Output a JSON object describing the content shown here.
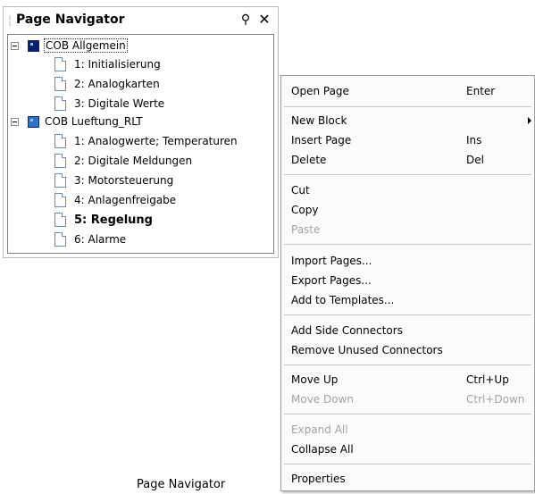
{
  "navigator": {
    "title": "Page Navigator",
    "pin_glyph": "⚲",
    "close_glyph": "✕",
    "tree": [
      {
        "label": "COB Allgemein",
        "type": "block",
        "expanded": true,
        "focused": true
      },
      {
        "label": "1: Initialisierung",
        "type": "page"
      },
      {
        "label": "2: Analogkarten",
        "type": "page"
      },
      {
        "label": "3: Digitale Werte",
        "type": "page"
      },
      {
        "label": "COB Lueftung_RLT",
        "type": "block",
        "expanded": true
      },
      {
        "label": "1: Analogwerte; Temperaturen",
        "type": "page"
      },
      {
        "label": "2: Digitale Meldungen",
        "type": "page"
      },
      {
        "label": "3: Motorsteuerung",
        "type": "page"
      },
      {
        "label": "4: Anlagenfreigabe",
        "type": "page"
      },
      {
        "label": "5: Regelung",
        "type": "page",
        "bold": true
      },
      {
        "label": "6: Alarme",
        "type": "page"
      }
    ]
  },
  "caption": "Page Navigator",
  "menu": {
    "open_page": {
      "label": "Open Page",
      "shortcut": "Enter"
    },
    "new_block": {
      "label": "New Block"
    },
    "insert_page": {
      "label": "Insert Page",
      "shortcut": "Ins"
    },
    "delete": {
      "label": "Delete",
      "shortcut": "Del"
    },
    "cut": {
      "label": "Cut"
    },
    "copy": {
      "label": "Copy"
    },
    "paste": {
      "label": "Paste",
      "disabled": true
    },
    "import_pages": {
      "label": "Import Pages..."
    },
    "export_pages": {
      "label": "Export Pages..."
    },
    "add_to_templates": {
      "label": "Add to Templates..."
    },
    "add_side_connectors": {
      "label": "Add Side Connectors"
    },
    "remove_unused_connectors": {
      "label": "Remove Unused Connectors"
    },
    "move_up": {
      "label": "Move Up",
      "shortcut": "Ctrl+Up"
    },
    "move_down": {
      "label": "Move Down",
      "shortcut": "Ctrl+Down",
      "disabled": true
    },
    "expand_all": {
      "label": "Expand All",
      "disabled": true
    },
    "collapse_all": {
      "label": "Collapse All"
    },
    "properties": {
      "label": "Properties"
    }
  }
}
